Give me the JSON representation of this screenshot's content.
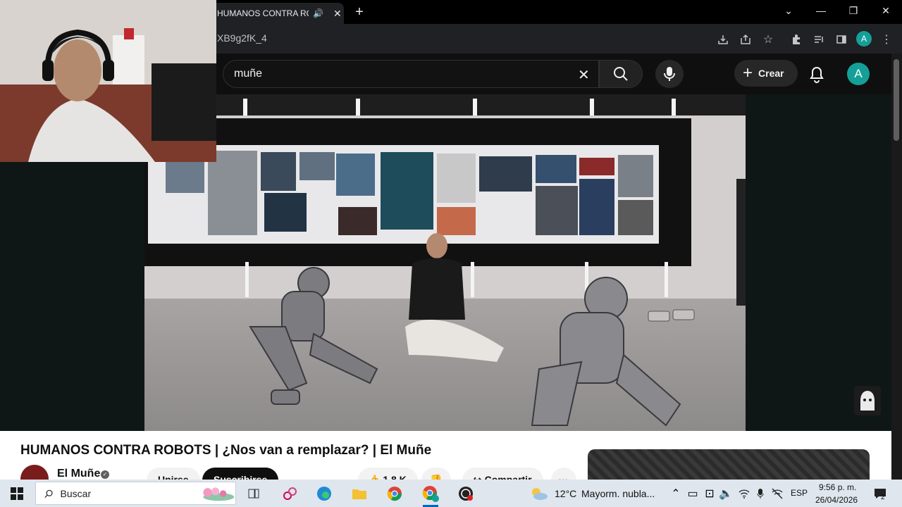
{
  "browser": {
    "tab_title": "HUMANOS CONTRA ROBOTS",
    "url_fragment": "XB9g2fK_4",
    "avatar_letter": "A"
  },
  "youtube": {
    "search_value": "muñe",
    "create_label": "Crear",
    "avatar_letter": "A"
  },
  "video": {
    "title": "HUMANOS CONTRA ROBOTS | ¿Nos van a remplazar? | El Muñe",
    "channel_name": "El Muñe",
    "join_label": "Unirse",
    "subscribe_label": "Suscribirse",
    "likes_label": "1,8 K",
    "share_label": "Compartir"
  },
  "taskbar": {
    "search_placeholder": "Buscar",
    "weather_temp": "12°C",
    "weather_text": "Mayorm. nubla...",
    "language": "ESP",
    "time": "9:56 p. m.",
    "date": "26/04/2026",
    "notification_count": "2"
  },
  "colors": {
    "accent_teal": "#14a098",
    "yt_bg": "#0f0f0f",
    "taskbar_bg": "#dfe6ee"
  }
}
